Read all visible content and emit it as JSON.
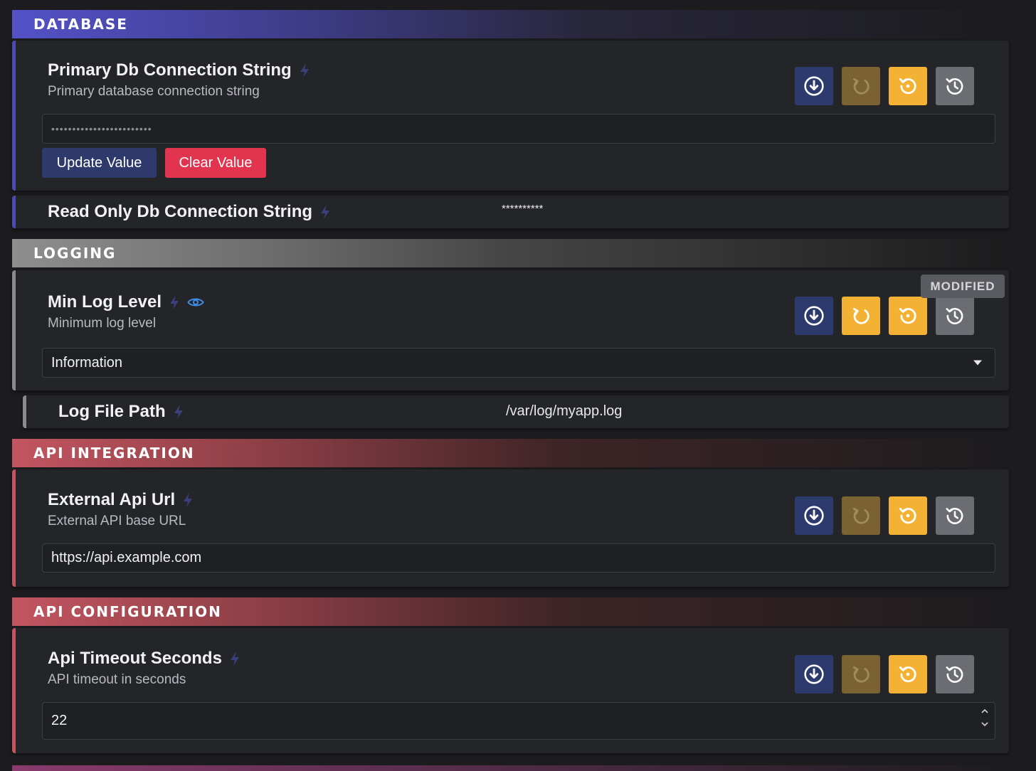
{
  "sections": {
    "database": "DATABASE",
    "logging": "LOGGING",
    "api_integration": "API INTEGRATION",
    "api_configuration": "API CONFIGURATION"
  },
  "settings": {
    "primary_db": {
      "title": "Primary Db Connection String",
      "description": "Primary database connection string",
      "value": "••••••••••••••••••••••••",
      "update_label": "Update Value",
      "clear_label": "Clear Value"
    },
    "readonly_db": {
      "title": "Read Only Db Connection String",
      "value": "**********"
    },
    "min_log_level": {
      "title": "Min Log Level",
      "description": "Minimum log level",
      "value": "Information",
      "badge": "MODIFIED"
    },
    "log_file_path": {
      "title": "Log File Path",
      "value": "/var/log/myapp.log"
    },
    "external_api_url": {
      "title": "External Api Url",
      "description": "External API base URL",
      "value": "https://api.example.com"
    },
    "api_timeout": {
      "title": "Api Timeout Seconds",
      "description": "API timeout in seconds",
      "value": "22"
    }
  },
  "icons": {
    "save": "download-circle-icon",
    "undo": "undo-icon",
    "reset": "reset-icon",
    "history": "history-icon",
    "bolt": "lightning-bolt-icon",
    "eye": "eye-icon"
  },
  "colors": {
    "save_button": "#2d3a6e",
    "undo_disabled": "#7a6232",
    "reset_button": "#f3b233",
    "history_button": "#6b6d73",
    "clear_button": "#e2334f",
    "database_accent": "#4c4bb0",
    "logging_accent": "#8a8a8a",
    "api_accent": "#c25560"
  }
}
